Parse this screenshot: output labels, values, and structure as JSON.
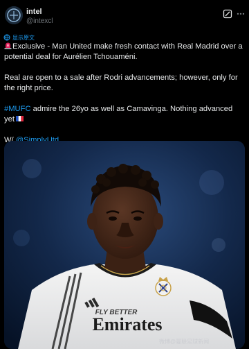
{
  "author": {
    "display_name": "intel",
    "handle": "@intexcl"
  },
  "header_icons": [
    "grok-icon",
    "more-icon"
  ],
  "translate_label": "显示原文",
  "tweet": {
    "p1_text": "Exclusive - Man United make fresh contact with Real Madrid over a potential deal for Aurélien Tchouaméni.",
    "p2_text": "Real are open to a sale after Rodri advancements; however, only for the right price.",
    "p3_hashtag": "#MUFC",
    "p3_text": " admire the 26yo as well as Camavinga. Nothing advanced yet",
    "p4_prefix": "W/ ",
    "p4_mention": "@SimplyUtd"
  },
  "media": {
    "shirt_sponsor": "Emirates",
    "shirt_slogan": "FLY BETTER",
    "watermark": "微博@曼联足球新闻"
  },
  "colors": {
    "background": "#000000",
    "text": "#e7e9ea",
    "muted": "#71767b",
    "link": "#1d9bf0"
  }
}
